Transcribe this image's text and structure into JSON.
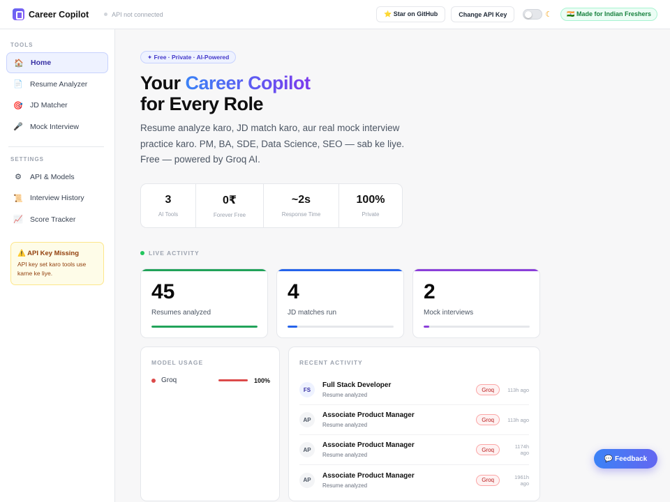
{
  "topbar": {
    "brand": "Career Copilot",
    "api_status": "API not connected",
    "github_label": "⭐ Star on GitHub",
    "api_key_label": "Change API Key",
    "theme_icon": "moon-icon",
    "made_badge": "🇮🇳 Made for Indian Freshers"
  },
  "sidebar": {
    "tools_heading": "TOOLS",
    "tools": [
      {
        "icon": "🏠",
        "label": "Home"
      },
      {
        "icon": "📄",
        "label": "Resume Analyzer"
      },
      {
        "icon": "🎯",
        "label": "JD Matcher"
      },
      {
        "icon": "🎤",
        "label": "Mock Interview"
      }
    ],
    "settings_heading": "SETTINGS",
    "settings": [
      {
        "icon": "⚙",
        "label": "API & Models"
      },
      {
        "icon": "📜",
        "label": "Interview History"
      },
      {
        "icon": "📈",
        "label": "Score Tracker"
      }
    ],
    "warning": {
      "title": "⚠️ API Key Missing",
      "text": "API key set karo tools use karne ke liye."
    }
  },
  "hero": {
    "badge": "✦ Free · Private · AI-Powered",
    "title_prefix": "Your ",
    "title_accent": "Career Copilot",
    "title_line2": "for Every Role",
    "subtitle": "Resume analyze karo, JD match karo, aur real mock interview practice karo. PM, BA, SDE, Data Science, SEO — sab ke liye. Free — powered by Groq AI."
  },
  "stats": [
    {
      "value": "3",
      "label": "AI Tools"
    },
    {
      "value": "0₹",
      "label": "Forever Free"
    },
    {
      "value": "~2s",
      "label": "Response Time"
    },
    {
      "value": "100%",
      "label": "Private"
    }
  ],
  "live_activity": {
    "heading": "LIVE ACTIVITY",
    "cards": [
      {
        "value": "45",
        "label": "Resumes analyzed",
        "progress": 1.0,
        "color": "#22a35a"
      },
      {
        "value": "4",
        "label": "JD matches run",
        "progress": 0.09,
        "color": "#2563eb"
      },
      {
        "value": "2",
        "label": "Mock interviews",
        "progress": 0.05,
        "color": "#8b3fd9"
      }
    ]
  },
  "model_usage": {
    "heading": "MODEL USAGE",
    "items": [
      {
        "name": "Groq",
        "percent_label": "100%",
        "percent": 100
      }
    ]
  },
  "recent_activity": {
    "heading": "RECENT ACTIVITY",
    "items": [
      {
        "initials": "FS",
        "title": "Full Stack Developer",
        "subtitle": "Resume analyzed",
        "model": "Groq",
        "time": "113h ago"
      },
      {
        "initials": "AP",
        "title": "Associate Product Manager",
        "subtitle": "Resume analyzed",
        "model": "Groq",
        "time": "113h ago"
      },
      {
        "initials": "AP",
        "title": "Associate Product Manager",
        "subtitle": "Resume analyzed",
        "model": "Groq",
        "time": "1174h ago"
      },
      {
        "initials": "AP",
        "title": "Associate Product Manager",
        "subtitle": "Resume analyzed",
        "model": "Groq",
        "time": "1961h ago"
      }
    ]
  },
  "feedback_label": "💬 Feedback"
}
